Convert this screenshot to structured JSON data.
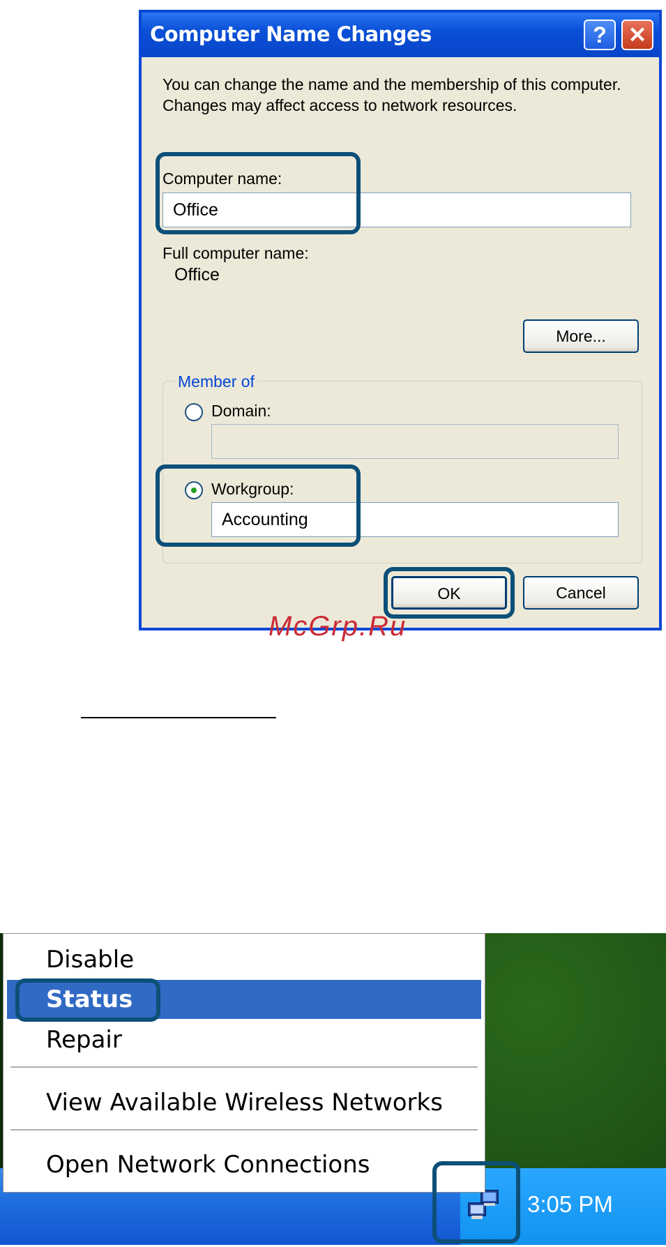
{
  "dialog": {
    "title": "Computer Name Changes",
    "help_button": "?",
    "close_button": "✕",
    "description": "You can change the name and the membership of this computer. Changes may affect access to network resources.",
    "computer_name_label": "Computer name:",
    "computer_name_value": "Office",
    "full_name_label": "Full computer name:",
    "full_name_value": "Office",
    "more_button": "More...",
    "member_of_label": "Member of",
    "domain_label": "Domain:",
    "domain_value": "",
    "workgroup_label": "Workgroup:",
    "workgroup_value": "Accounting",
    "selected_membership": "workgroup",
    "ok_button": "OK",
    "cancel_button": "Cancel"
  },
  "watermark": "McGrp.Ru",
  "context_menu": {
    "items": [
      {
        "label": "Disable",
        "selected": false
      },
      {
        "label": "Status",
        "selected": true
      },
      {
        "label": "Repair",
        "selected": false
      },
      {
        "label": "View Available Wireless Networks",
        "selected": false
      },
      {
        "label": "Open Network Connections",
        "selected": false
      }
    ]
  },
  "taskbar": {
    "clock": "3:05 PM",
    "tray_icon": "network-connection-icon"
  },
  "colors": {
    "title_bar": "#0a50d8",
    "dialog_bg": "#ece9d8",
    "highlight_box": "#0c4f78",
    "menu_selected": "#316ac5",
    "watermark": "#cc2a36"
  }
}
